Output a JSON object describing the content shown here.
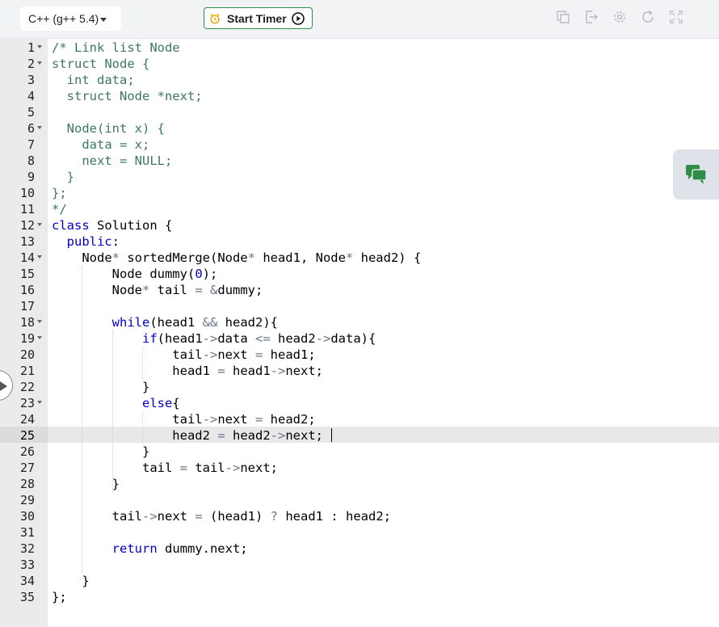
{
  "toolbar": {
    "language": "C++ (g++ 5.4)",
    "timer_label": "Start Timer",
    "icons": [
      "copy-icon",
      "sign-out-icon",
      "settings-icon",
      "reset-icon",
      "fullscreen-icon"
    ]
  },
  "editor": {
    "active_line": 25,
    "lines": [
      {
        "n": "1",
        "fold": true,
        "text": "/* Link list Node"
      },
      {
        "n": "2",
        "fold": true,
        "text": "struct Node {"
      },
      {
        "n": "3",
        "fold": false,
        "text": "  int data;"
      },
      {
        "n": "4",
        "fold": false,
        "text": "  struct Node *next;"
      },
      {
        "n": "5",
        "fold": false,
        "text": ""
      },
      {
        "n": "6",
        "fold": true,
        "text": "  Node(int x) {"
      },
      {
        "n": "7",
        "fold": false,
        "text": "    data = x;"
      },
      {
        "n": "8",
        "fold": false,
        "text": "    next = NULL;"
      },
      {
        "n": "9",
        "fold": false,
        "text": "  }"
      },
      {
        "n": "10",
        "fold": false,
        "text": "};"
      },
      {
        "n": "11",
        "fold": false,
        "text": "*/"
      },
      {
        "n": "12",
        "fold": true,
        "text": "class Solution {"
      },
      {
        "n": "13",
        "fold": false,
        "text": "  public:"
      },
      {
        "n": "14",
        "fold": true,
        "text": "    Node* sortedMerge(Node* head1, Node* head2) {"
      },
      {
        "n": "15",
        "fold": false,
        "text": "        Node dummy(0);"
      },
      {
        "n": "16",
        "fold": false,
        "text": "        Node* tail = &dummy;"
      },
      {
        "n": "17",
        "fold": false,
        "text": ""
      },
      {
        "n": "18",
        "fold": true,
        "text": "        while(head1 && head2){"
      },
      {
        "n": "19",
        "fold": true,
        "text": "            if(head1->data <= head2->data){"
      },
      {
        "n": "20",
        "fold": false,
        "text": "                tail->next = head1;"
      },
      {
        "n": "21",
        "fold": false,
        "text": "                head1 = head1->next;"
      },
      {
        "n": "22",
        "fold": false,
        "text": "            }"
      },
      {
        "n": "23",
        "fold": true,
        "text": "            else{"
      },
      {
        "n": "24",
        "fold": false,
        "text": "                tail->next = head2;"
      },
      {
        "n": "25",
        "fold": false,
        "text": "                head2 = head2->next;"
      },
      {
        "n": "26",
        "fold": false,
        "text": "            }"
      },
      {
        "n": "27",
        "fold": false,
        "text": "            tail = tail->next;"
      },
      {
        "n": "28",
        "fold": false,
        "text": "        }"
      },
      {
        "n": "29",
        "fold": false,
        "text": ""
      },
      {
        "n": "30",
        "fold": false,
        "text": "        tail->next = (head1) ? head1 : head2;"
      },
      {
        "n": "31",
        "fold": false,
        "text": ""
      },
      {
        "n": "32",
        "fold": false,
        "text": "        return dummy.next;"
      },
      {
        "n": "33",
        "fold": false,
        "text": ""
      },
      {
        "n": "34",
        "fold": false,
        "text": "    }"
      },
      {
        "n": "35",
        "fold": false,
        "text": "};"
      }
    ]
  },
  "side_button": {
    "icon": "chat-icon"
  },
  "colors": {
    "accent_green": "#2f8d46",
    "comment": "#3d7a5a",
    "keyword": "#0000cc",
    "operator": "#687687",
    "number": "#0000cd"
  }
}
